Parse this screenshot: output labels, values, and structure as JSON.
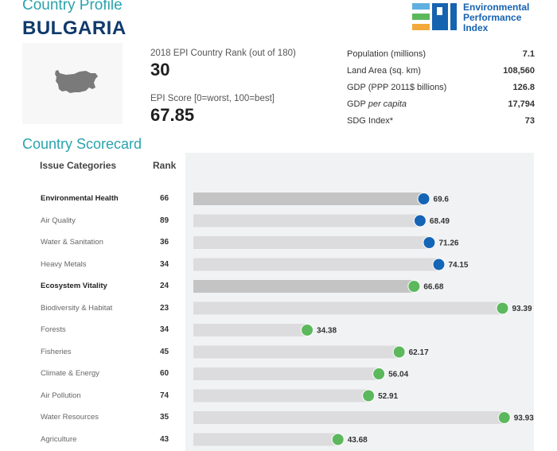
{
  "header": {
    "subtitle": "Country Profile",
    "country": "BULGARIA",
    "logo_text": [
      "Environmental",
      "Performance",
      "Index"
    ]
  },
  "profile": {
    "rank_label": "2018 EPI Country Rank (out of 180)",
    "rank_value": "30",
    "score_label": "EPI Score [0=worst, 100=best]",
    "score_value": "67.85",
    "map_icon": "bulgaria-map-silhouette"
  },
  "stats": [
    {
      "label": "Population (millions)",
      "value": "7.1"
    },
    {
      "label": "Land Area (sq. km)",
      "value": "108,560"
    },
    {
      "label": "GDP (PPP 2011$ billions)",
      "value": "126.8"
    },
    {
      "label": "GDP per capita",
      "value": "17,794"
    },
    {
      "label": "SDG Index*",
      "value": "73"
    }
  ],
  "scorecard": {
    "title": "Country Scorecard",
    "col_category": "Issue Categories",
    "col_rank": "Rank"
  },
  "colors": {
    "teal_heading": "#2aa3ad",
    "navy_title": "#0f3a6b",
    "health_dot": "#1565b6",
    "ecosystem_dot": "#5cb85c",
    "bar_major": "#c4c4c4",
    "bar_minor": "#dcdcde",
    "panel_bg": "#f1f2f4"
  },
  "chart_data": {
    "type": "bar",
    "orientation": "horizontal",
    "title": "Country Scorecard",
    "xlim": [
      0,
      100
    ],
    "categories": [
      "Environmental Health",
      "Air Quality",
      "Water & Sanitation",
      "Heavy Metals",
      "Ecosystem Vitality",
      "Biodiversity & Habitat",
      "Forests",
      "Fisheries",
      "Climate & Energy",
      "Air Pollution",
      "Water Resources",
      "Agriculture"
    ],
    "ranks": [
      66,
      89,
      36,
      34,
      24,
      23,
      34,
      45,
      60,
      74,
      35,
      43
    ],
    "values": [
      69.6,
      68.49,
      71.26,
      74.15,
      66.68,
      93.39,
      34.38,
      62.17,
      56.04,
      52.91,
      93.93,
      43.68
    ],
    "labels": [
      "69.6",
      "68.49",
      "71.26",
      "74.15",
      "66.68",
      "93.39",
      "34.38",
      "62.17",
      "56.04",
      "52.91",
      "93.93",
      "43.68"
    ],
    "major": [
      true,
      false,
      false,
      false,
      true,
      false,
      false,
      false,
      false,
      false,
      false,
      false
    ],
    "group": [
      "health",
      "health",
      "health",
      "health",
      "ecosystem",
      "ecosystem",
      "ecosystem",
      "ecosystem",
      "ecosystem",
      "ecosystem",
      "ecosystem",
      "ecosystem"
    ],
    "grid": false,
    "legend": "none"
  }
}
